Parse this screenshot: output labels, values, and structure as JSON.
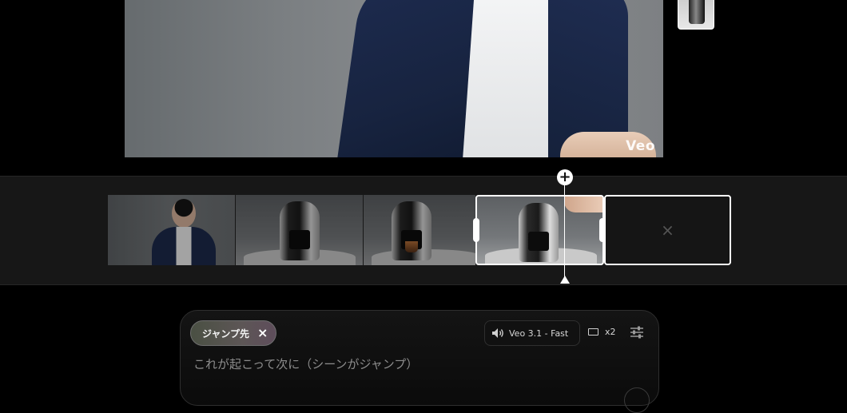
{
  "preview": {
    "watermark": "Veo"
  },
  "timeline": {
    "add_symbol": "+",
    "empty_slot_symbol": "×",
    "clips": [
      "person",
      "coffee-machine",
      "coffee-brewing",
      "coffee-hand",
      "empty"
    ]
  },
  "composer": {
    "chip_label": "ジャンプ先",
    "chip_close": "×",
    "model_label": "Veo 3.1 - Fast",
    "count_label": "x2",
    "prompt_placeholder": "これが起こって次に（シーンがジャンプ）"
  },
  "icons": {
    "speaker": "speaker-icon",
    "aspect": "aspect-ratio-icon",
    "settings": "sliders-icon"
  }
}
